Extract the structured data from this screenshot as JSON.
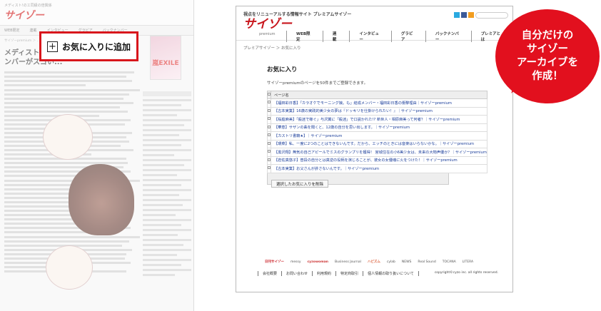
{
  "left_page": {
    "tag_line": "メディスト!のエ同級の倍興係",
    "logo": "サイゾー",
    "nav": [
      "WEB限定",
      "連載",
      "インタビュー",
      "グラビア",
      "バックナンバー"
    ],
    "crumb": "サイゾーpremium ＞ ...",
    "title_lines": [
      "メディスト!お...",
      "ンバーがスゴい..."
    ],
    "magazine_label": "嵐EXILE",
    "fav_button_label": "お気に入りに追加"
  },
  "right_page": {
    "tagline": "視点をリニューアルする情報サイト プレミアムサイゾー",
    "logo": "サイゾー",
    "logo_sub": "premium",
    "nav": [
      "WEB限定",
      "連載",
      "インタビュー",
      "グラビア",
      "バックナンバー",
      "プレミアとは"
    ],
    "crumb": "プレミアサイゾー ＞ お気に入り",
    "heading": "お気に入り",
    "description": "サイゾーpremiumのページを50件までご登録できます。",
    "table_header": "ページ名",
    "rows": [
      "【福田彩日香】「カラオケでモーニング娘。も」結成メンバー・福田彩日香の衝撃理由｜サイゾーpremium",
      "【古本実業】16歳の実践的美少女の夢は『ドッキリを仕掛けられたい！』｜サイゾーpremium",
      "【桜庭麻美】「殺迷で稼ぐ」与沢翼に「殺迷」で口説かれた!? 新世人・相原麻美って何者？｜サイゾーpremium",
      "【華恵】サザンの曲を聞くと、12歳の自分を思い出します。｜サイゾーpremium",
      "【カストリ書籍★】｜サイゾーpremium",
      "【環菜】私、一度に2つのことはできないんです。だから、エッチのときには音楽はいらないかな。｜サイゾーpremium",
      "【黒沢翔】無気の自己アピールでミスのグランプリを獲得！ 宮城住在の小6美少女は、未来の大物声優か？｜サイゾーpremium",
      "【岩佐真悠子】普段の自分とは真逆の役柄を演じることが、彼女の女優魂に火をつけた！｜サイゾーpremium",
      "【古本実業】お父さんが許さないんです。｜サイゾーpremium"
    ],
    "delete_button": "選択したお気に入りを削除",
    "partners": [
      "日刊サイゾー",
      "messy",
      "cyzowoman",
      "Business Journal",
      "ハピズム",
      "cylab",
      "NEWS",
      "Real Sound",
      "TOCANA",
      "LITERA"
    ],
    "footer_links": [
      "会社概要",
      "お問い合わせ",
      "利用規約",
      "特定商取引",
      "個人情報の取り扱いについて"
    ],
    "copyright": "copyright©cyzo inc. all rights reserved."
  },
  "callout": {
    "lines": [
      "自分だけの",
      "サイゾー",
      "アーカイブを",
      "作成！"
    ]
  },
  "colors": {
    "accent_red": "#e2101e",
    "link_blue": "#1a3d9a"
  }
}
